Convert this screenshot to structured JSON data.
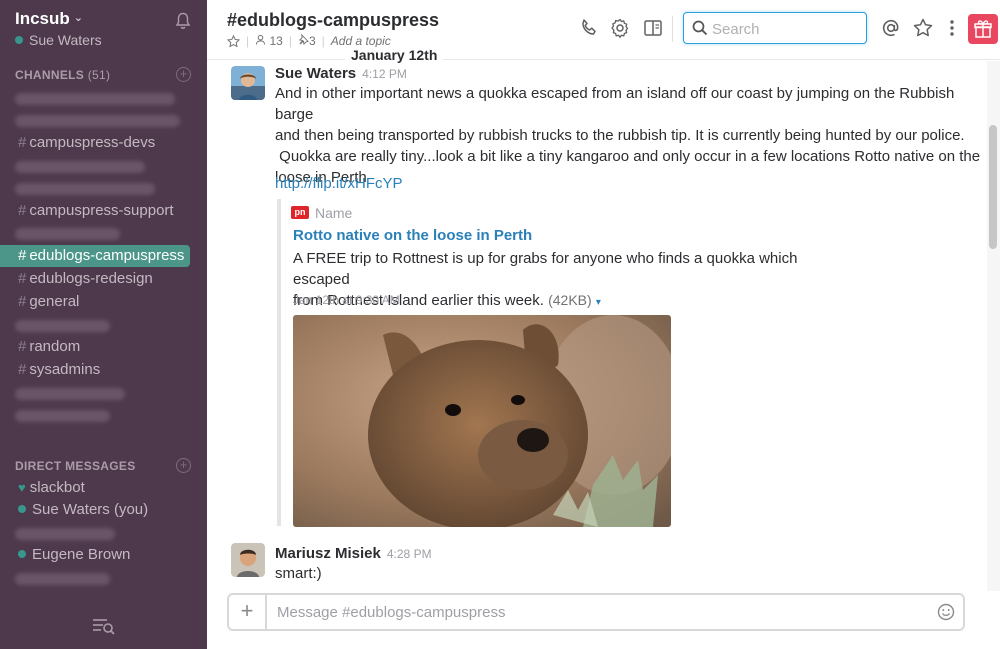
{
  "team": {
    "name": "Incsub",
    "chevron": "⌄",
    "user": "Sue Waters"
  },
  "channels": {
    "heading": "CHANNELS",
    "count": "(51)",
    "items": [
      {
        "label": "campuspress-devs",
        "active": false
      },
      {
        "label": "campuspress-support",
        "active": false
      },
      {
        "label": "edublogs-campuspress",
        "active": true
      },
      {
        "label": "edublogs-redesign",
        "active": false
      },
      {
        "label": "general",
        "active": false
      },
      {
        "label": "random",
        "active": false
      },
      {
        "label": "sysadmins",
        "active": false
      }
    ]
  },
  "direct_messages": {
    "heading": "DIRECT MESSAGES",
    "items": [
      "slackbot",
      "Sue Waters (you)",
      "Eugene Brown"
    ]
  },
  "header": {
    "title": "#edublogs-campuspress",
    "members": "13",
    "pins": "3",
    "topic": "Add a topic",
    "search_placeholder": "Search"
  },
  "date_divider": "January 12th",
  "messages": [
    {
      "author": "Sue Waters",
      "time": "4:12 PM",
      "text_lines": [
        "And in other important news a quokka escaped from an island off our coast by jumping on the Rubbish barge",
        "and then being transported by rubbish trucks to the rubbish tip.  It is currently being hunted by our police.",
        " Quokka are really tiny...look a bit like a tiny kangaroo and only occur in a few locations Rotto native on the",
        "loose in Perth"
      ],
      "link": "http://flip.it/xHFcYP",
      "attachment": {
        "source_badge": "pn",
        "source": "Name",
        "title": "Rotto native on the loose in Perth",
        "text_line1": "A FREE trip to Rottnest is up for grabs for anyone who finds a quokka which escaped",
        "text_line2": "from Rottnest Island earlier this week.",
        "size": "(42KB)",
        "caret": "▾",
        "date": "Jan 12th at 9:30 AM"
      }
    },
    {
      "author": "Mariusz Misiek",
      "time": "4:28 PM",
      "text": "smart:)"
    }
  ],
  "composer": {
    "plus": "+",
    "placeholder": "Message #edublogs-campuspress"
  },
  "icons": [
    "bell-icon",
    "phone-icon",
    "gear-icon",
    "sidebar-toggle-icon",
    "search-icon",
    "mention-icon",
    "star-icon",
    "more-icon",
    "gift-icon",
    "emoji-icon",
    "quick-switcher-icon"
  ],
  "colors": {
    "sidebar": "#4d394b",
    "active_channel": "#4c9689",
    "presence": "#38978d",
    "link": "#2a80b9",
    "search_border": "#2d9ee0",
    "gift": "#e8475f"
  }
}
